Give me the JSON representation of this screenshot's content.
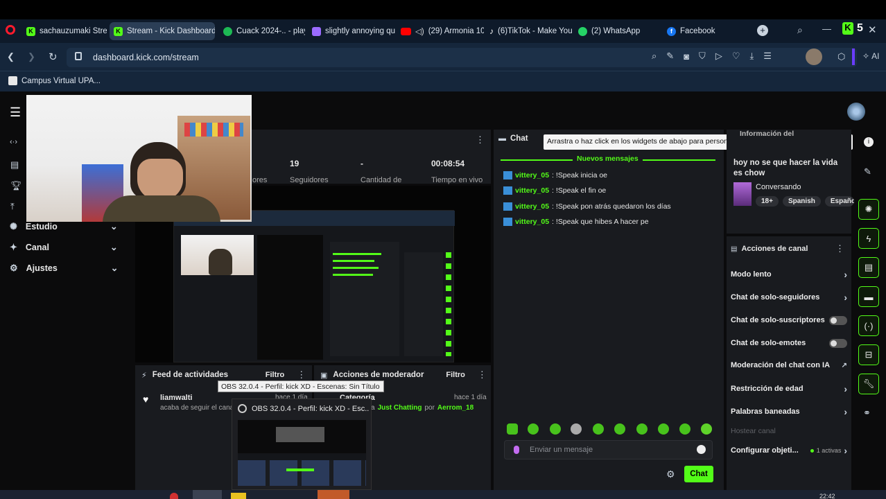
{
  "browser": {
    "tabs": [
      {
        "label": "sachauzumaki Stre",
        "icon": "kick-icon",
        "color": "#53fc18",
        "active": false
      },
      {
        "label": "Stream - Kick Dashboard",
        "icon": "kick-icon",
        "color": "#53fc18",
        "active": true
      },
      {
        "label": "Cuack 2024-.. - play",
        "icon": "spotify-icon",
        "color": "#1db954",
        "active": false
      },
      {
        "label": "slightly annoying qu",
        "icon": "twitch-like-icon",
        "color": "#9b6bff",
        "active": false
      },
      {
        "label": "(29) Armonia 10",
        "icon": "youtube-icon",
        "color": "#ff0000",
        "active": false
      },
      {
        "label": "(6)TikTok - Make You",
        "icon": "tiktok-icon",
        "color": "#ffffff",
        "active": false
      },
      {
        "label": "(2) WhatsApp",
        "icon": "whatsapp-icon",
        "color": "#25d366",
        "active": false
      },
      {
        "label": "Facebook",
        "icon": "facebook-icon",
        "color": "#1877f2",
        "active": false
      }
    ],
    "url": "dashboard.kick.com/stream",
    "bookmark": "Campus Virtual UPA...",
    "ai_label": "AI",
    "badge_count": "5"
  },
  "stats": {
    "followers_value": "19",
    "followers_label": "Seguidores",
    "views_label": "ores",
    "dash_value": "-",
    "amount_label": "Cantidad de",
    "time_value": "00:08:54",
    "time_label": "Tiempo en vivo"
  },
  "sidebar": {
    "items": [
      {
        "label": "Estudio",
        "icon": "studio-icon"
      },
      {
        "label": "Canal",
        "icon": "channel-icon"
      },
      {
        "label": "Ajustes",
        "icon": "gear-icon"
      }
    ]
  },
  "chat": {
    "title": "Chat",
    "tooltip": "Arrastra o haz click en los widgets de abajo para personalizar tu propio panel de control",
    "new_messages": "Nuevos mensajes",
    "messages": [
      {
        "user": "vittery_05",
        "text": ": !Speak inicia oe"
      },
      {
        "user": "vittery_05",
        "text": ": !Speak el fin oe"
      },
      {
        "user": "vittery_05",
        "text": ": !Speak pon atrás quedaron los días"
      },
      {
        "user": "vittery_05",
        "text": ": !Speak que hibes A hacer pe"
      }
    ],
    "input_placeholder": "Enviar un mensaje",
    "send_label": "Chat"
  },
  "info": {
    "header": "Información del",
    "title": "hoy no se que hacer la vida es chow",
    "category": "Conversando",
    "tags": [
      "18+",
      "Spanish",
      "Españo"
    ]
  },
  "channel_actions": {
    "title": "Acciones de canal",
    "items": [
      {
        "label": "Modo lento",
        "control": "chevron"
      },
      {
        "label": "Chat de solo-seguidores",
        "control": "chevron"
      },
      {
        "label": "Chat de solo-suscriptores",
        "control": "toggle"
      },
      {
        "label": "Chat de solo-emotes",
        "control": "toggle"
      },
      {
        "label": "Moderación del chat con IA",
        "control": "external"
      },
      {
        "label": "Restricción de edad",
        "control": "chevron"
      },
      {
        "label": "Palabras baneadas",
        "control": "chevron"
      }
    ],
    "host_label": "Hostear canal",
    "goals_label": "Configurar objeti...",
    "goals_active": "1 activas"
  },
  "activity": {
    "title": "Feed de actividades",
    "filter": "Filtro",
    "user": "liamwalti",
    "text": "acaba de seguir el cana",
    "time": "hace 1 día"
  },
  "mod": {
    "title": "Acciones de moderador",
    "filter": "Filtro",
    "category_label": "Categoría",
    "time": "hace 1 día",
    "text_prefix": "a",
    "category": "Just Chatting",
    "by": "por",
    "mod_user": "Aerrom_18"
  },
  "obs": {
    "tooltip": "OBS 32.0.4 - Perfil: kick XD - Escenas: Sin Título",
    "window_title": "OBS 32.0.4 - Perfil: kick XD - Esc..."
  },
  "taskbar": {
    "time": "22:42"
  }
}
